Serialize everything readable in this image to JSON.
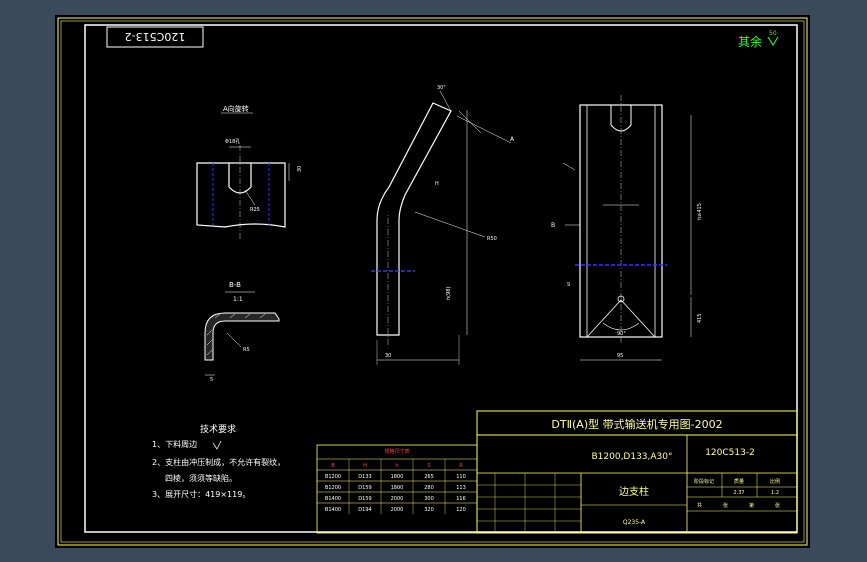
{
  "drawing": {
    "number_stamp": "120C513-2",
    "surface_finish": {
      "prefix": "其余",
      "value": "50"
    },
    "view_a_title": "A向旋转",
    "section_title": "B-B",
    "section_scale": "1:1",
    "tech_req_title": "技术要求",
    "tech_req": [
      "1、下料周边",
      "2、支柱由冲压制成，不允许有裂纹，",
      "四棱，须须等缺陷。",
      "3、展开尺寸：419×119。"
    ],
    "dims": {
      "slot_w": "Φ18孔",
      "slot_h": "30",
      "slot_r": "R25",
      "bend_r": "R5",
      "thk": "5",
      "ang": "30°",
      "r_bend": "R50",
      "dim_a": "A",
      "d_30": "30",
      "d_h": "H",
      "height_h": "h(98)",
      "d_b": "B",
      "d_s": "S",
      "w_95": "95",
      "h_415": "415",
      "angle_90": "90°",
      "h_total": "h≥415"
    },
    "title_block": {
      "main_title": "DTⅡ(A)型  带式输送机专用图-2002",
      "spec": "B1200,D133,A30°",
      "code": "120C513-2",
      "part_name": "边支柱",
      "material": "Q235-A",
      "weight_label": "质量",
      "scale_label": "比例",
      "weight": "2.37",
      "scale": "1:2",
      "sheet_labels": [
        "共",
        "张",
        "第",
        "张"
      ],
      "stage_label": "阶段标记"
    },
    "param_table": {
      "title": "规格尺寸表",
      "headers": [
        "B",
        "H",
        "h",
        "S",
        "R"
      ],
      "rows": [
        [
          "B1200",
          "D133",
          "1800",
          "265",
          "110"
        ],
        [
          "B1200",
          "D159",
          "1800",
          "280",
          "113"
        ],
        [
          "B1400",
          "D159",
          "2000",
          "300",
          "116"
        ],
        [
          "B1400",
          "D194",
          "2000",
          "320",
          "120"
        ]
      ]
    }
  }
}
